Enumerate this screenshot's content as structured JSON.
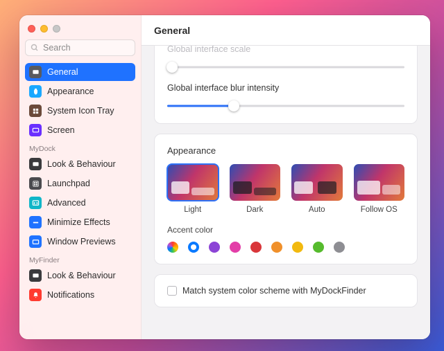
{
  "header": {
    "title": "General"
  },
  "search": {
    "placeholder": "Search"
  },
  "sidebar": {
    "items": [
      {
        "label": "General",
        "icon": "general-icon",
        "color": "#5a5a5e",
        "active": true
      },
      {
        "label": "Appearance",
        "icon": "appearance-icon",
        "color": "#1aa8ff"
      },
      {
        "label": "System Icon Tray",
        "icon": "tray-icon",
        "color": "#6b4a3a"
      },
      {
        "label": "Screen",
        "icon": "screen-icon",
        "color": "#6a2fff"
      }
    ],
    "section_mydock": "MyDock",
    "mydock": [
      {
        "label": "Look & Behaviour",
        "icon": "look-icon",
        "color": "#3a3a3d"
      },
      {
        "label": "Launchpad",
        "icon": "launchpad-icon",
        "color": "#4a4a4e"
      },
      {
        "label": "Advanced",
        "icon": "advanced-icon",
        "color": "#10b6c8"
      },
      {
        "label": "Minimize Effects",
        "icon": "minimize-icon",
        "color": "#1f72ff"
      },
      {
        "label": "Window Previews",
        "icon": "previews-icon",
        "color": "#1f72ff"
      }
    ],
    "section_myfinder": "MyFinder",
    "myfinder": [
      {
        "label": "Look & Behaviour",
        "icon": "look-icon",
        "color": "#3a3a3d"
      },
      {
        "label": "Notifications",
        "icon": "notifications-icon",
        "color": "#ff3b30"
      }
    ]
  },
  "panel": {
    "scale_label": "Global interface scale",
    "scale_value": 0,
    "blur_label": "Global interface blur intensity",
    "blur_value": 28,
    "appearance_title": "Appearance",
    "themes": [
      {
        "label": "Light",
        "key": "light",
        "selected": true
      },
      {
        "label": "Dark",
        "key": "dark"
      },
      {
        "label": "Auto",
        "key": "auto"
      },
      {
        "label": "Follow OS",
        "key": "follow"
      }
    ],
    "accent_label": "Accent color",
    "accents": [
      {
        "name": "multicolor",
        "css": "conic-gradient(#ff3b30,#ff9500,#ffcc00,#34c759,#007aff,#af52de,#ff3b30)"
      },
      {
        "name": "blue",
        "css": "#0a7aff",
        "selected": true
      },
      {
        "name": "purple",
        "css": "#8c44d6"
      },
      {
        "name": "pink",
        "css": "#e33ea8"
      },
      {
        "name": "red",
        "css": "#d9363a"
      },
      {
        "name": "orange",
        "css": "#f0902b"
      },
      {
        "name": "yellow",
        "css": "#f2b90f"
      },
      {
        "name": "green",
        "css": "#56bb2d"
      },
      {
        "name": "graphite",
        "css": "#8e8e93"
      }
    ],
    "match_label": "Match system color scheme with MyDockFinder",
    "match_checked": false
  }
}
